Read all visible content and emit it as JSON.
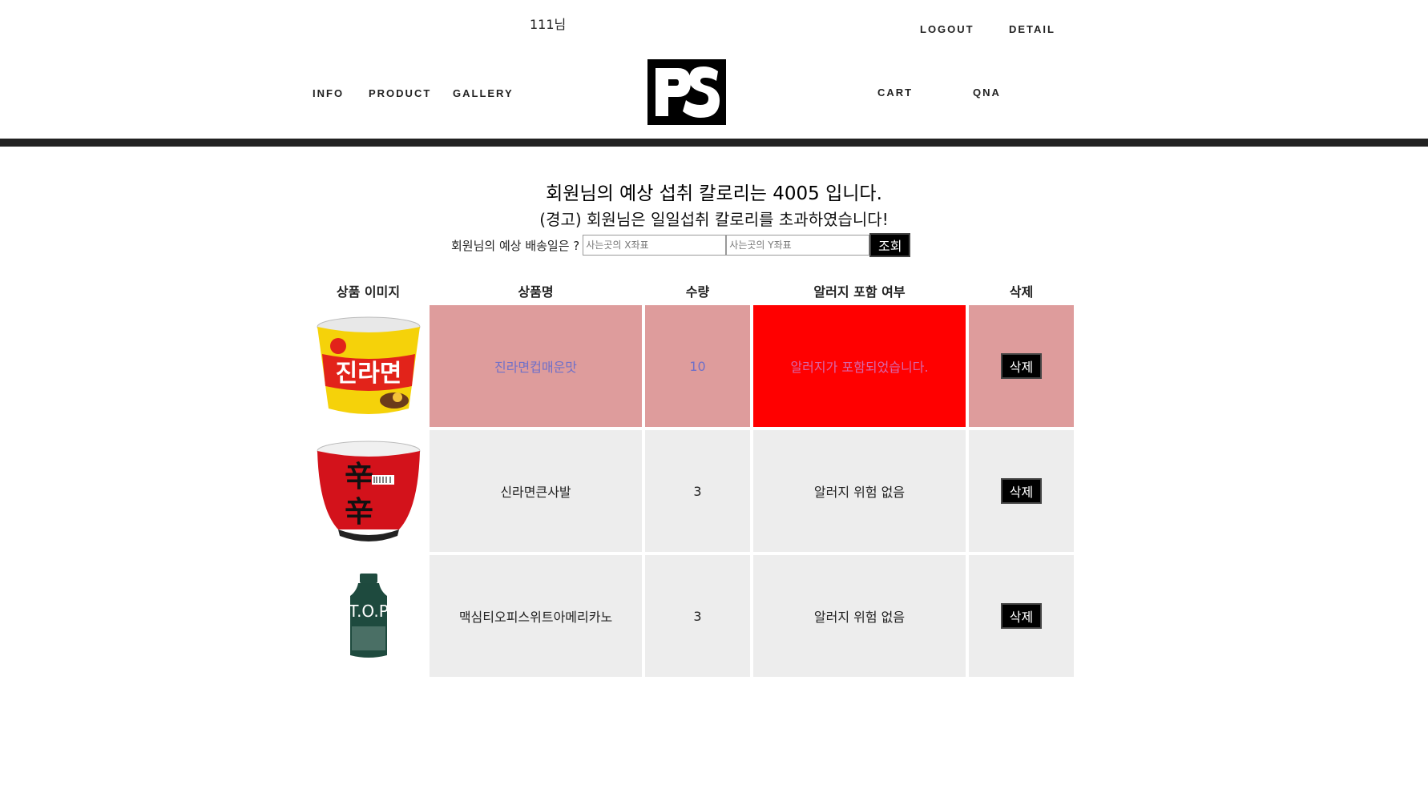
{
  "header": {
    "user_greeting": "111님",
    "top_links": {
      "logout": "LOGOUT",
      "detail": "DETAIL"
    },
    "nav_left": {
      "info": "INFO",
      "product": "PRODUCT",
      "gallery": "GALLERY"
    },
    "nav_right": {
      "cart": "CART",
      "qna": "QNA"
    },
    "logo_text": "PS"
  },
  "summary": {
    "calorie_text": "회원님의 예상 섭취 칼로리는 4005 입니다.",
    "warning_text": "(경고) 회원님은 일일섭취 칼로리를 초과하였습니다!",
    "delivery_label": "회원님의 예상 배송일은 ?",
    "x_placeholder": "사는곳의 X좌표",
    "y_placeholder": "사는곳의 Y좌표",
    "query_label": "조회"
  },
  "table": {
    "headers": {
      "image": "상품 이미지",
      "name": "상품명",
      "qty": "수량",
      "allergy": "알러지 포함 여부",
      "delete": "삭제"
    },
    "rows": [
      {
        "name": "진라면컵매운맛",
        "qty": "10",
        "allergy": "알러지가 포함되었습니다.",
        "delete_label": "삭제"
      },
      {
        "name": "신라면큰사발",
        "qty": "3",
        "allergy": "알러지 위험 없음",
        "delete_label": "삭제"
      },
      {
        "name": "맥심티오피스위트아메리카노",
        "qty": "3",
        "allergy": "알러지 위험 없음",
        "delete_label": "삭제"
      }
    ]
  },
  "colors": {
    "row_warning_bg": "#de9c9c",
    "allergy_alert_bg": "#ff0000",
    "row_normal_bg": "#ededed",
    "header_divider": "#222222"
  }
}
